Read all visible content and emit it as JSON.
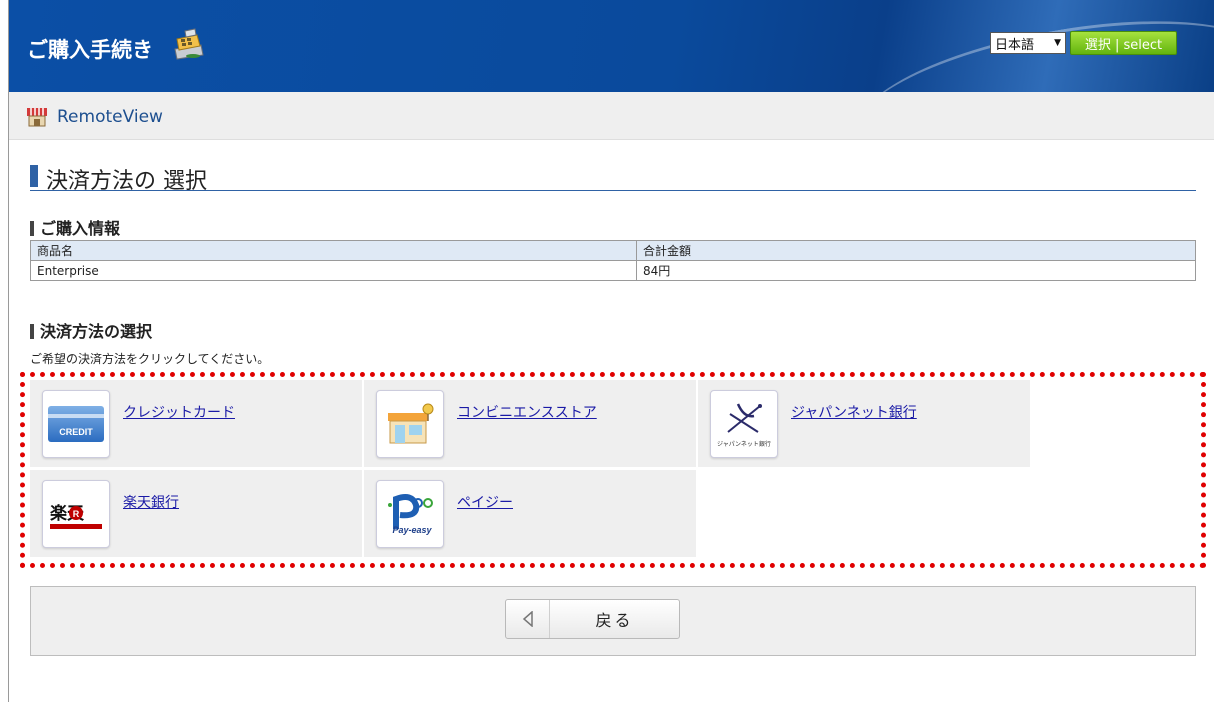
{
  "header": {
    "title": "ご購入手続き",
    "language": {
      "selected": "日本語",
      "button_label": "選択 | select"
    }
  },
  "shop": {
    "name": "RemoteView"
  },
  "page": {
    "title": "決済方法の 選択"
  },
  "purchase_info": {
    "heading": "ご購入情報",
    "columns": [
      "商品名",
      "合計金額"
    ],
    "rows": [
      {
        "product": "Enterprise",
        "total": "84円"
      }
    ]
  },
  "payment": {
    "heading": "決済方法の選択",
    "instruction": "ご希望の決済方法をクリックしてください。",
    "methods": [
      {
        "label": "クレジットカード",
        "icon": "credit-card-icon",
        "logo_text": "CREDIT"
      },
      {
        "label": "コンビニエンスストア",
        "icon": "convenience-store-icon"
      },
      {
        "label": "ジャパンネット銀行",
        "icon": "japan-net-bank-icon",
        "logo_text": "ジャパンネット銀行"
      },
      {
        "label": "楽天銀行",
        "icon": "rakuten-bank-icon",
        "logo_text": "楽天"
      },
      {
        "label": "ペイジー",
        "icon": "pay-easy-icon",
        "logo_text": "Pay-easy"
      }
    ]
  },
  "footer": {
    "back_label": "戻る"
  },
  "colors": {
    "header_blue": "#0b4fa6",
    "accent_green": "#63b40f",
    "link_blue": "#1a1aa6",
    "highlight_red": "#e00000"
  }
}
